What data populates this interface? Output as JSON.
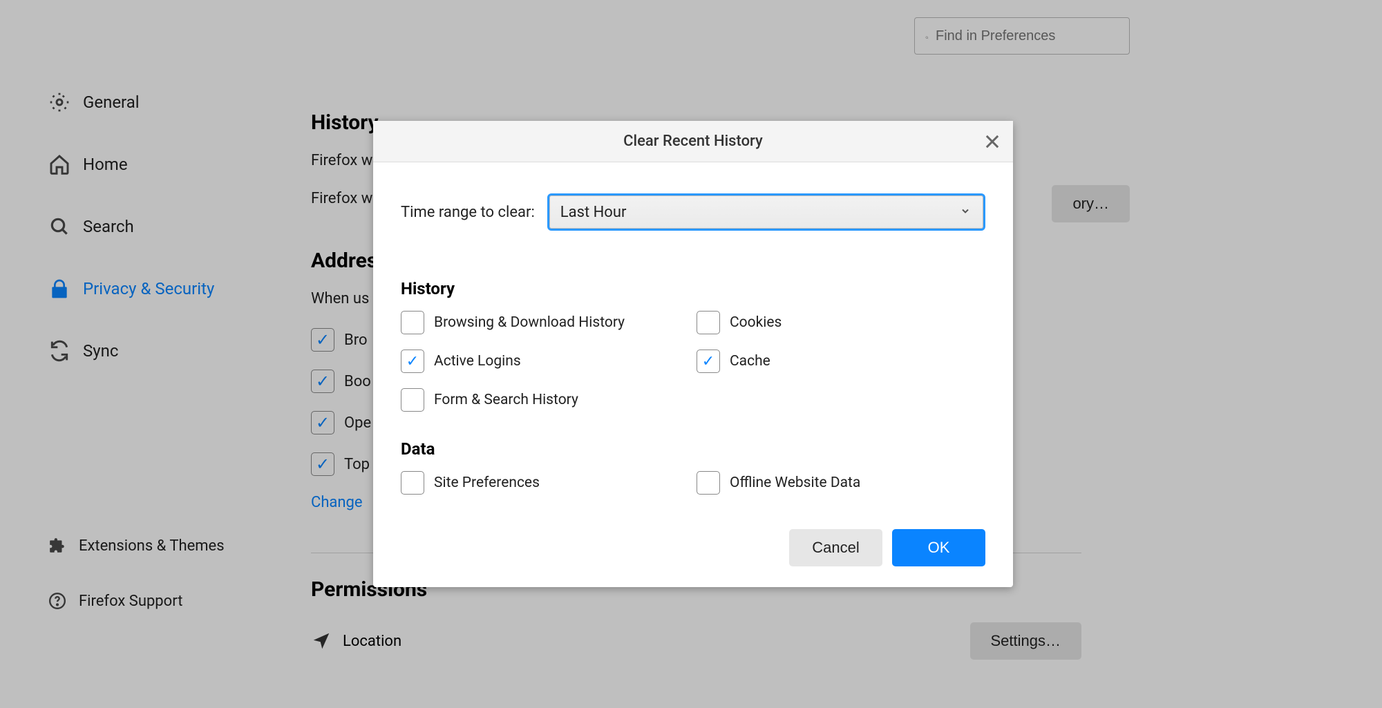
{
  "sidebar": {
    "items": [
      {
        "label": "General"
      },
      {
        "label": "Home"
      },
      {
        "label": "Search"
      },
      {
        "label": "Privacy & Security"
      },
      {
        "label": "Sync"
      }
    ],
    "bottom": [
      {
        "label": "Extensions & Themes"
      },
      {
        "label": "Firefox Support"
      }
    ]
  },
  "search": {
    "placeholder": "Find in Preferences"
  },
  "content": {
    "history_title": "History",
    "firefox_will": "Firefox w",
    "firefox_will2": "Firefox w",
    "clear_history_btn": "ory…",
    "address_title": "Addres",
    "when_using": "When us",
    "chk1": "Bro",
    "chk2": "Boo",
    "chk3": "Ope",
    "chk4": "Top",
    "change_link": "Change",
    "permissions_title": "Permissions",
    "location": "Location",
    "settings_btn": "Settings…"
  },
  "dialog": {
    "title": "Clear Recent History",
    "time_label": "Time range to clear:",
    "time_value": "Last Hour",
    "history_section": "History",
    "data_section": "Data",
    "options": {
      "browsing": "Browsing & Download History",
      "cookies": "Cookies",
      "active_logins": "Active Logins",
      "cache": "Cache",
      "form_search": "Form & Search History",
      "site_prefs": "Site Preferences",
      "offline_data": "Offline Website Data"
    },
    "cancel": "Cancel",
    "ok": "OK"
  }
}
